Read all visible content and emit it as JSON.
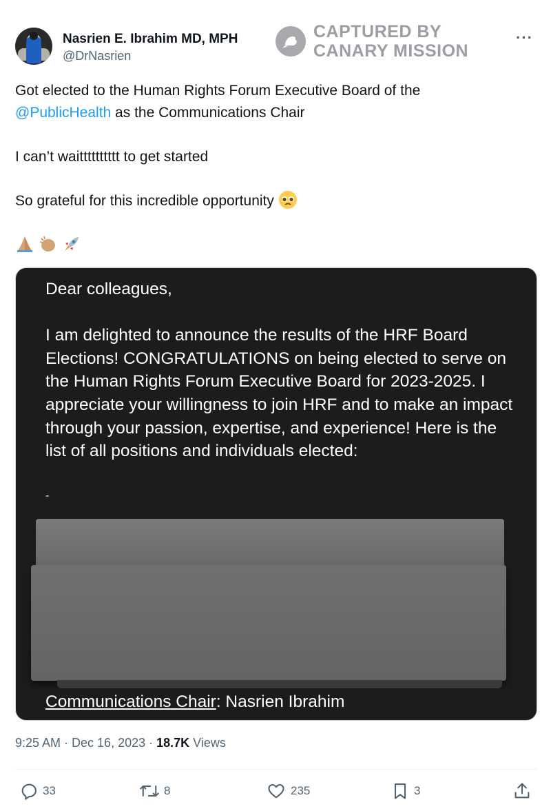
{
  "tweet": {
    "author_name": "Nasrien E. Ibrahim MD, MPH",
    "author_handle": "@DrNasrien",
    "more_label": "···",
    "text_line1a": "Got elected to the Human Rights Forum Executive Board of the",
    "mention": "@PublicHealth",
    "text_line1b": " as the Communications Chair",
    "text_line2": "I can’t waitttttttttt to get started",
    "text_line3": "So grateful for this incredible opportunity",
    "emoji_names": [
      "pleading-face-emoji",
      "folded-hands-emoji",
      "clapping-hands-emoji",
      "rocket-emoji"
    ],
    "timestamp": "9:25 AM · Dec 16, 2023 · ",
    "views_count": "18.7K",
    "views_label": " Views"
  },
  "watermark": {
    "line1": "CAPTURED BY",
    "line2": "CANARY MISSION"
  },
  "media": {
    "greeting": "Dear colleagues,",
    "body": "I am delighted to announce the results of the HRF Board Elections! CONGRATULATIONS on being elected to serve on the Human Rights Forum Executive Board for 2023-2025. I appreciate your willingness to join HRF and to make an impact through your passion, expertise, and experience! Here is the list of all positions and individuals elected:",
    "dash": "-",
    "position_label": "Communications Chair",
    "position_value": ": Nasrien Ibrahim"
  },
  "actions": {
    "replies": "33",
    "reposts": "8",
    "likes": "235",
    "bookmarks": "3"
  },
  "colors": {
    "accent": "#1d9bf0",
    "muted": "#536471",
    "media_bg": "#1c1c1e",
    "redaction": "#6e6e70"
  }
}
